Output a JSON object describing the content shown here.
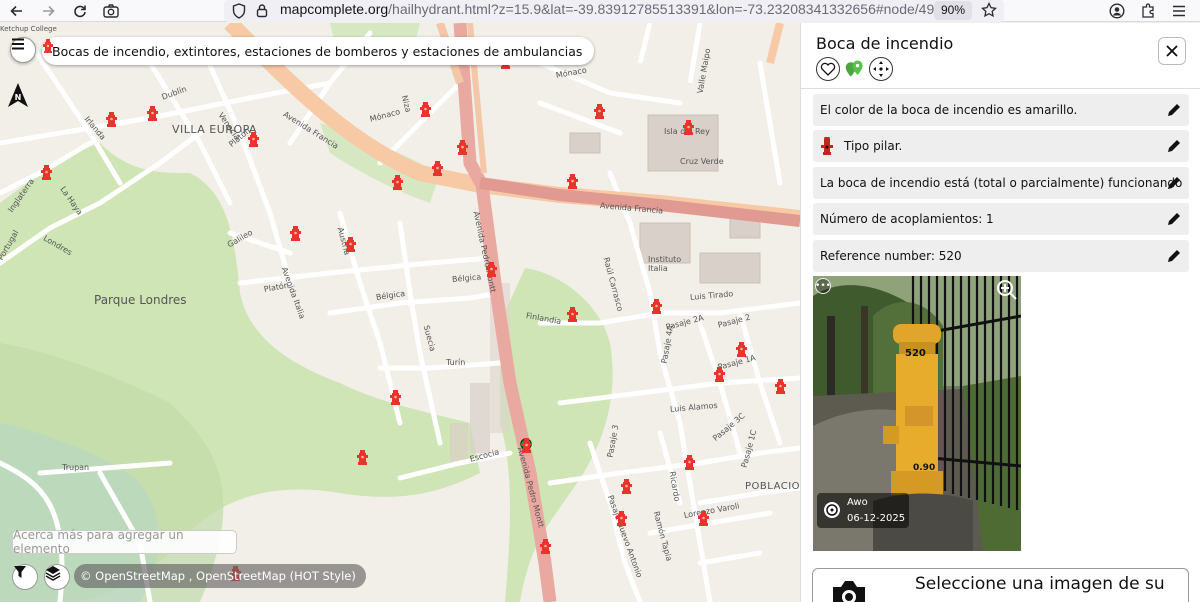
{
  "browser": {
    "url_host": "mapcomplete.org",
    "url_rest": "/hailhydrant.html?z=15.9&lat=-39.83912785513391&lon=-73.23208341332656#node/49",
    "zoom": "90%",
    "icons": [
      "back-icon",
      "forward-icon",
      "reload-icon",
      "screenshot-icon",
      "shield-icon",
      "lock-icon",
      "star-icon",
      "account-icon",
      "extensions-icon",
      "menu-icon"
    ]
  },
  "map": {
    "layer_title": "Bocas de incendio, extintores, estaciones de bomberos y estaciones de ambulancias",
    "add_hint": "Acerca más para agregar un elemento",
    "attribution": "© OpenStreetMap , OpenStreetMap (HOT Style)",
    "places": {
      "villa_europa": "VILLA EUROPA",
      "parque_londres": "Parque Londres",
      "instituto": "Instituto\nItalia",
      "poblacion": "POBLACIO",
      "cruz_verde": "Cruz Verde",
      "ketchup": "Ketchup College"
    },
    "streets": {
      "dublin": "Dublín",
      "irlanda": "Irlanda",
      "venecia": "Venecia",
      "inglaterra": "Inglaterra",
      "la_haya": "La Haya",
      "londres": "Londres",
      "portugal": "Portugal",
      "platon1": "Platón",
      "platon2": "Platón",
      "galileo": "Galileo",
      "austria": "Austria",
      "avenida_italia": "Avenida Italia",
      "belgica1": "Bélgica",
      "belgica2": "Bélgica",
      "suecia": "Suecia",
      "turin": "Turín",
      "finlandia": "Finlandia",
      "monaco1": "Mónaco",
      "monaco2": "Mónaco",
      "niza": "Niza",
      "avenida_francia": "Avenida Francia",
      "avenida_francia2": "Avenida Francia",
      "isla_rey": "Isla del Rey",
      "valle_maipo": "Valle Maipo",
      "raul_carrasco": "Raúl Carrasco",
      "luis_tirado": "Luis Tirado",
      "pasaje2a": "Pasaje 2A",
      "pasaje2": "Pasaje 2",
      "pasaje4a": "Pasaje 4A",
      "pasaje1a": "Pasaje 1A",
      "luis_alamos": "Luis Alamos",
      "pasaje3c": "Pasaje 3C",
      "pasaje3": "Pasaje 3",
      "pasaje1c": "Pasaje 1C",
      "pasaje_n": "Pasaje N",
      "escocia": "Escocia",
      "avenida_pedro_montt": "Avenida Pedro Montt",
      "avenida_pedro_montt2": "Avenida Pedro Montt",
      "trupan": "Trupan",
      "lorenzo_varoli": "Lorenzo Varoli",
      "ramon_tapia": "Ramón Tapia",
      "pasaje_antonio": "Pasaje Nuevo Antonio",
      "ricardo": "Ricardo"
    }
  },
  "panel": {
    "title": "Boca de incendio",
    "questions": [
      "El color de la boca de incendio es amarillo.",
      "Tipo pilar.",
      "La boca de incendio está (total o parcialmente) funcionando",
      "Número de acoplamientos: 1",
      "Reference number: 520"
    ],
    "photo": {
      "author": "Awo",
      "date": "06-12-2025",
      "number": "520",
      "plate": "0.90"
    },
    "upload_label": "Seleccione una imagen de su"
  }
}
